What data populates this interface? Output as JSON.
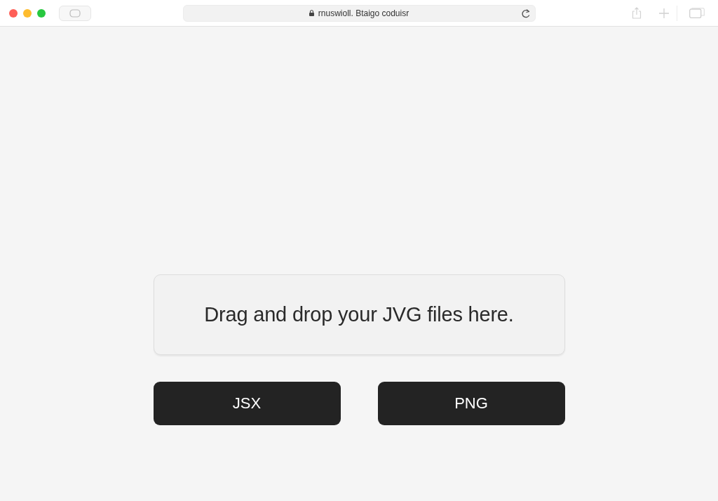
{
  "toolbar": {
    "address": "rnuswioll. Btaigo coduisr"
  },
  "drop_zone": {
    "text": "Drag and drop your JVG files here."
  },
  "buttons": [
    {
      "label": "JSX"
    },
    {
      "label": "PNG"
    }
  ]
}
